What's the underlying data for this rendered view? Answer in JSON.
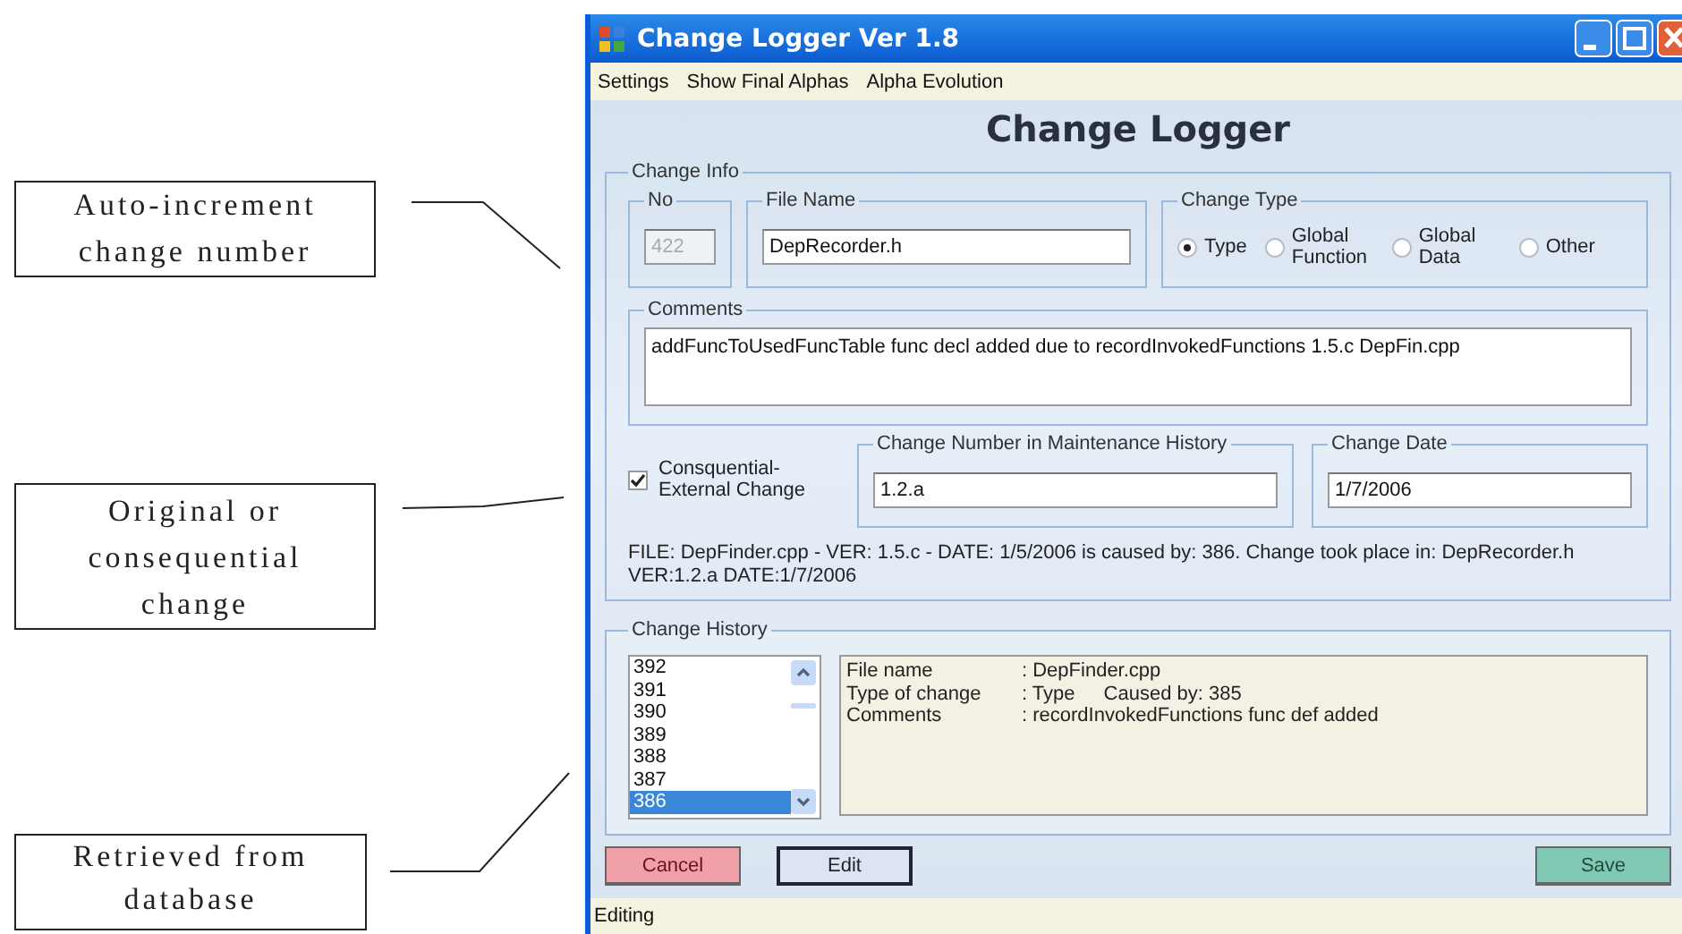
{
  "annotations": [
    {
      "text": "Auto-increment change number"
    },
    {
      "text": "Original or consequential change"
    },
    {
      "text": "Retrieved from database"
    }
  ],
  "window": {
    "title": "Change Logger Ver 1.8"
  },
  "menu": [
    "Settings",
    "Show Final Alphas",
    "Alpha Evolution"
  ],
  "heading": "Change Logger",
  "change_info": {
    "title": "Change Info",
    "no": {
      "label": "No",
      "value": "422",
      "disabled": true
    },
    "file_name": {
      "label": "File Name",
      "value": "DepRecorder.h"
    },
    "change_type": {
      "label": "Change Type",
      "options": [
        {
          "label": "Type",
          "selected": true
        },
        {
          "label": "Global Function",
          "selected": false
        },
        {
          "label": "Global Data",
          "selected": false
        },
        {
          "label": "Other",
          "selected": false
        }
      ]
    },
    "comments": {
      "label": "Comments",
      "value": "addFuncToUsedFuncTable func decl added due to recordInvokedFunctions 1.5.c DepFin.cpp"
    },
    "consequential": {
      "label": "Consquential-External Change",
      "checked": true
    },
    "maintenance": {
      "label": "Change Number in Maintenance History",
      "value": "1.2.a"
    },
    "change_date": {
      "label": "Change Date",
      "value": "1/7/2006"
    },
    "summary": "FILE: DepFinder.cpp - VER: 1.5.c - DATE: 1/5/2006 is caused by: 386. Change took place in: DepRecorder.h VER:1.2.a DATE:1/7/2006"
  },
  "change_history": {
    "title": "Change History",
    "list": [
      {
        "label": "392",
        "selected": false
      },
      {
        "label": "391",
        "selected": false
      },
      {
        "label": "390",
        "selected": false
      },
      {
        "label": "389",
        "selected": false
      },
      {
        "label": "388",
        "selected": false
      },
      {
        "label": "387",
        "selected": false
      },
      {
        "label": "386",
        "selected": true
      }
    ],
    "details": [
      {
        "label": "File name",
        "value": ": DepFinder.cpp"
      },
      {
        "label": "Type of change",
        "value": ": Type",
        "extra": "Caused by: 385"
      },
      {
        "label": "Comments",
        "value": ": recordInvokedFunctions func def added"
      }
    ]
  },
  "buttons": [
    {
      "label": "Cancel",
      "kind": "cancel"
    },
    {
      "label": "Edit",
      "kind": "edit"
    },
    {
      "label": "Save",
      "kind": "save"
    }
  ],
  "status": "Editing"
}
